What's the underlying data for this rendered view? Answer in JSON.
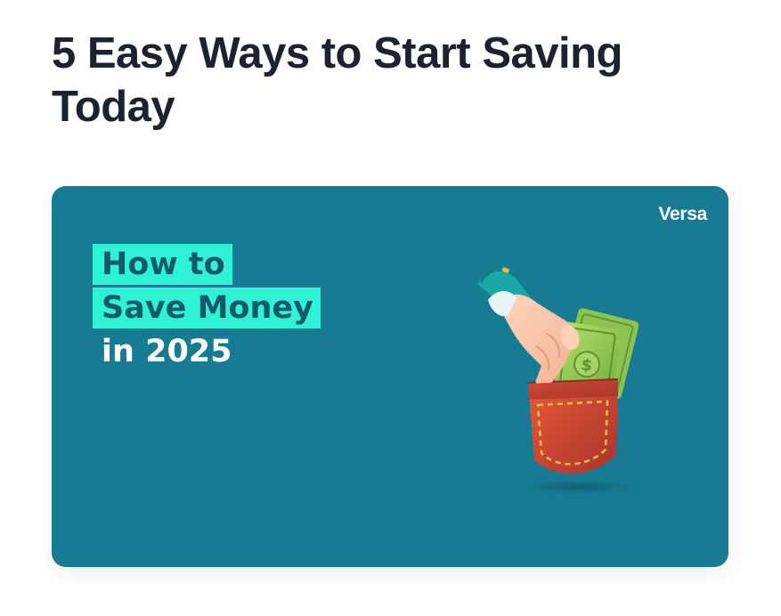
{
  "article": {
    "title": "5 Easy Ways to Start Saving Today"
  },
  "banner": {
    "brand": "Versa",
    "headline_lines": [
      "How to",
      "Save Money",
      "in 2025"
    ],
    "colors": {
      "background": "#177b93",
      "highlight": "#2ff2d4",
      "highlight_text": "#125a6b",
      "plain_text": "#ffffff"
    },
    "illustration": "hand-putting-money-in-pocket-icon"
  }
}
